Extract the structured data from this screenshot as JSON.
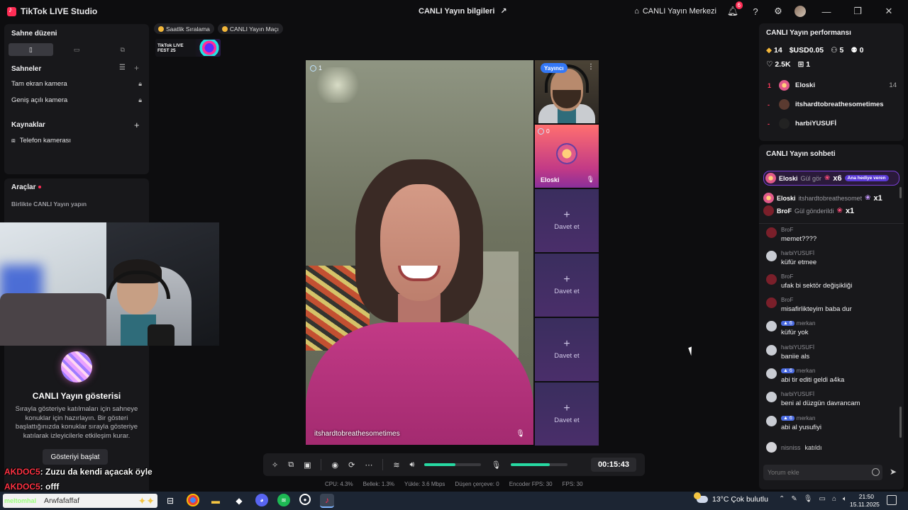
{
  "app": {
    "title": "TikTok LIVE Studio"
  },
  "titlebar": {
    "center_title": "CANLI Yayın bilgileri",
    "hub_label": "CANLI Yayın Merkezi",
    "notif_count": "6"
  },
  "left": {
    "scene_layout_title": "Sahne düzeni",
    "scenes_title": "Sahneler",
    "scenes": [
      "Tam ekran kamera",
      "Geniş açılı kamera"
    ],
    "sources_title": "Kaynaklar",
    "sources": [
      "Telefon kamerası"
    ],
    "tools_title": "Araçlar",
    "tools_sub": "Birlikte CANLI Yayın yapın",
    "show_title": "CANLI Yayın gösterisi",
    "show_desc": "Sırayla gösteriye katılmaları için sahneye konuklar için hazırlayın. Bir gösteri başlattığınızda konuklar sırayla gösteriye katılarak izleyicilerle etkileşim kurar.",
    "show_button": "Gösteriyi başlat"
  },
  "overlay_chat": [
    {
      "user": "AKDOC5",
      "text": ": Zuzu da kendi açacak öyle"
    },
    {
      "user": "AKDOC5",
      "text": ": offf"
    }
  ],
  "center": {
    "pills": [
      "Saatlik Sıralama",
      "CANLI Yayın Maçı"
    ],
    "fest_banner": "TikTok LIVE FEST 25",
    "main_viewers": "1",
    "main_name": "itshardtobreathesometimes",
    "host_badge": "Yayıncı",
    "guest_viewers": "0",
    "guest_name": "Eloski",
    "invite_label": "Davet et",
    "timer": "00:15:43",
    "volume_output": 0.55,
    "volume_mic": 0.68,
    "stats": [
      "CPU:  4.3%",
      "Bellek:  1.3%",
      "Yükle:  3.6 Mbps",
      "Düşen çerçeve:  0",
      "Encoder FPS:  30",
      "FPS:  30"
    ]
  },
  "perf": {
    "title": "CANLI Yayın performansı",
    "diamonds": "14",
    "usd": "USD0.05",
    "viewers": "5",
    "new_followers": "0",
    "likes": "2.5K",
    "gifters": "1",
    "ranking": [
      {
        "rank": "1",
        "name": "Eloski",
        "score": "14"
      },
      {
        "rank": "-",
        "name": "itshardtobreathesometimes",
        "score": ""
      },
      {
        "rank": "-",
        "name": "harbiYUSUFİ",
        "score": ""
      }
    ]
  },
  "chat": {
    "title": "CANLI Yayın sohbeti",
    "gifts": [
      {
        "user": "Eloski",
        "text": "Gül gör",
        "mult": "x6",
        "badge": "Ana hediye veren"
      },
      {
        "user": "Eloski",
        "text": "itshardtobreathesomet",
        "mult": "x1"
      },
      {
        "user": "BroF",
        "text": "Gül gönderildi",
        "mult": "x1"
      }
    ],
    "messages": [
      {
        "user": "BroF",
        "level": "",
        "text": "memet????"
      },
      {
        "user": "harbiYUSUFİ",
        "level": "",
        "text": "küfür etmee"
      },
      {
        "user": "BroF",
        "level": "",
        "text": "ufak bi sektör değişikliği"
      },
      {
        "user": "BroF",
        "level": "",
        "text": "misafirlikteyim baba dur"
      },
      {
        "user": "merkan",
        "level": "6",
        "text": "küfür yok"
      },
      {
        "user": "harbiYUSUFİ",
        "level": "",
        "text": "baniie als"
      },
      {
        "user": "merkan",
        "level": "6",
        "text": "abi tir editi geldi a4ka"
      },
      {
        "user": "harbiYUSUFİ",
        "level": "",
        "text": "beni al düzgün davrancam"
      },
      {
        "user": "merkan",
        "level": "6",
        "text": "abi al yusufiyi"
      }
    ],
    "join_user": "nisniss",
    "join_text": "katıldı",
    "input_placeholder": "Yorum ekle"
  },
  "taskbar": {
    "search_text": "Arwfafaffaf",
    "search_overlay": "meltomhal",
    "weather": "13°C  Çok bulutlu",
    "time": "21:50",
    "date": "15.11.2025"
  }
}
